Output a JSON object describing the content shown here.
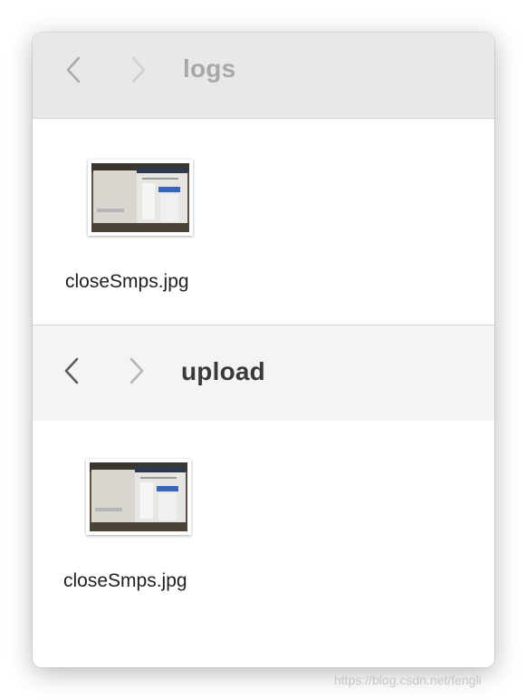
{
  "panes": [
    {
      "folder_title": "logs",
      "back_icon": "chevron-left-icon",
      "forward_icon": "chevron-right-icon",
      "file": {
        "name": "closeSmps.jpg",
        "icon": "image-thumbnail"
      }
    },
    {
      "folder_title": "upload",
      "back_icon": "chevron-left-icon",
      "forward_icon": "chevron-right-icon",
      "file": {
        "name": "closeSmps.jpg",
        "icon": "image-thumbnail"
      }
    }
  ],
  "watermark": "https://blog.csdn.net/fengli",
  "colors": {
    "top_toolbar": "#e8e8e8",
    "bottom_toolbar": "#f3f4f4",
    "title_inactive": "#a8a8a8",
    "title_active": "#3a3a3a"
  }
}
